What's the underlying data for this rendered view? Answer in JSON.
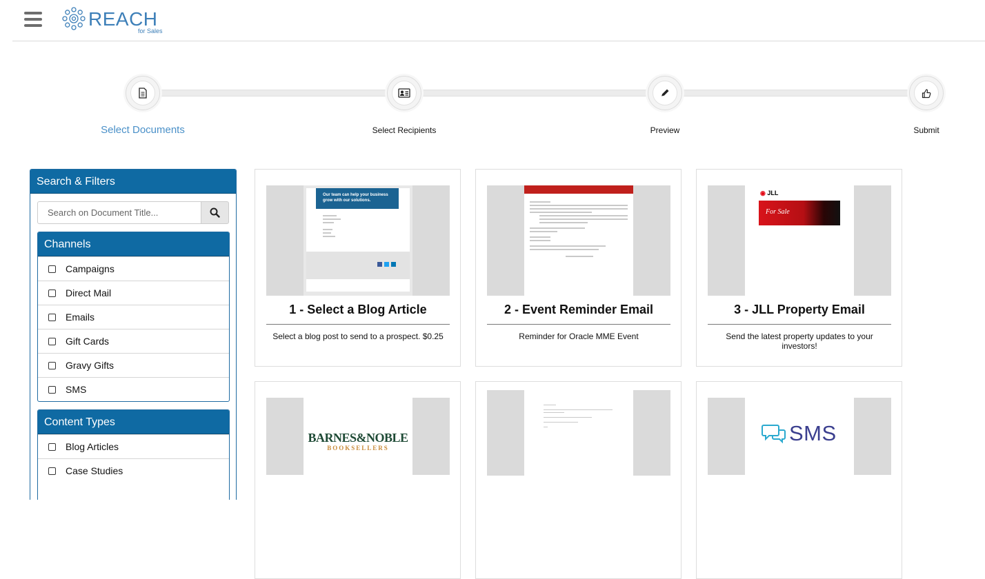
{
  "header": {
    "logo_text": "REACH",
    "logo_sub": "for Sales"
  },
  "stepper": {
    "steps": [
      {
        "label": "Select Documents",
        "icon": "document-icon",
        "active": true
      },
      {
        "label": "Select Recipients",
        "icon": "contact-card-icon",
        "active": false
      },
      {
        "label": "Preview",
        "icon": "pencil-icon",
        "active": false
      },
      {
        "label": "Submit",
        "icon": "thumbs-up-icon",
        "active": false
      }
    ]
  },
  "sidebar": {
    "title": "Search & Filters",
    "search_placeholder": "Search on Document Title...",
    "channels": {
      "title": "Channels",
      "items": [
        "Campaigns",
        "Direct Mail",
        "Emails",
        "Gift Cards",
        "Gravy Gifts",
        "SMS"
      ]
    },
    "content_types": {
      "title": "Content Types",
      "items": [
        "Blog Articles",
        "Case Studies"
      ]
    }
  },
  "cards": [
    {
      "title": "1 - Select a Blog Article",
      "description": "Select a blog post to send to a prospect. $0.25",
      "thumb_heading": "Our team can help your business grow with our solutions."
    },
    {
      "title": "2 - Event Reminder Email",
      "description": "Reminder for Oracle MME Event"
    },
    {
      "title": "3 - JLL Property Email",
      "description": "Send the latest property updates to your investors!",
      "thumb_brand": "JLL",
      "thumb_banner": "For Sale"
    },
    {
      "title": "",
      "description": "",
      "thumb_brand_1": "BARNES&NOBLE",
      "thumb_brand_2": "BOOKSELLERS"
    },
    {
      "title": "",
      "description": ""
    },
    {
      "title": "",
      "description": "",
      "thumb_brand": "SMS"
    }
  ],
  "colors": {
    "brand_blue": "#0f6aa3",
    "active_step": "#4a90c8",
    "logo_blue": "#3d7fb8"
  }
}
